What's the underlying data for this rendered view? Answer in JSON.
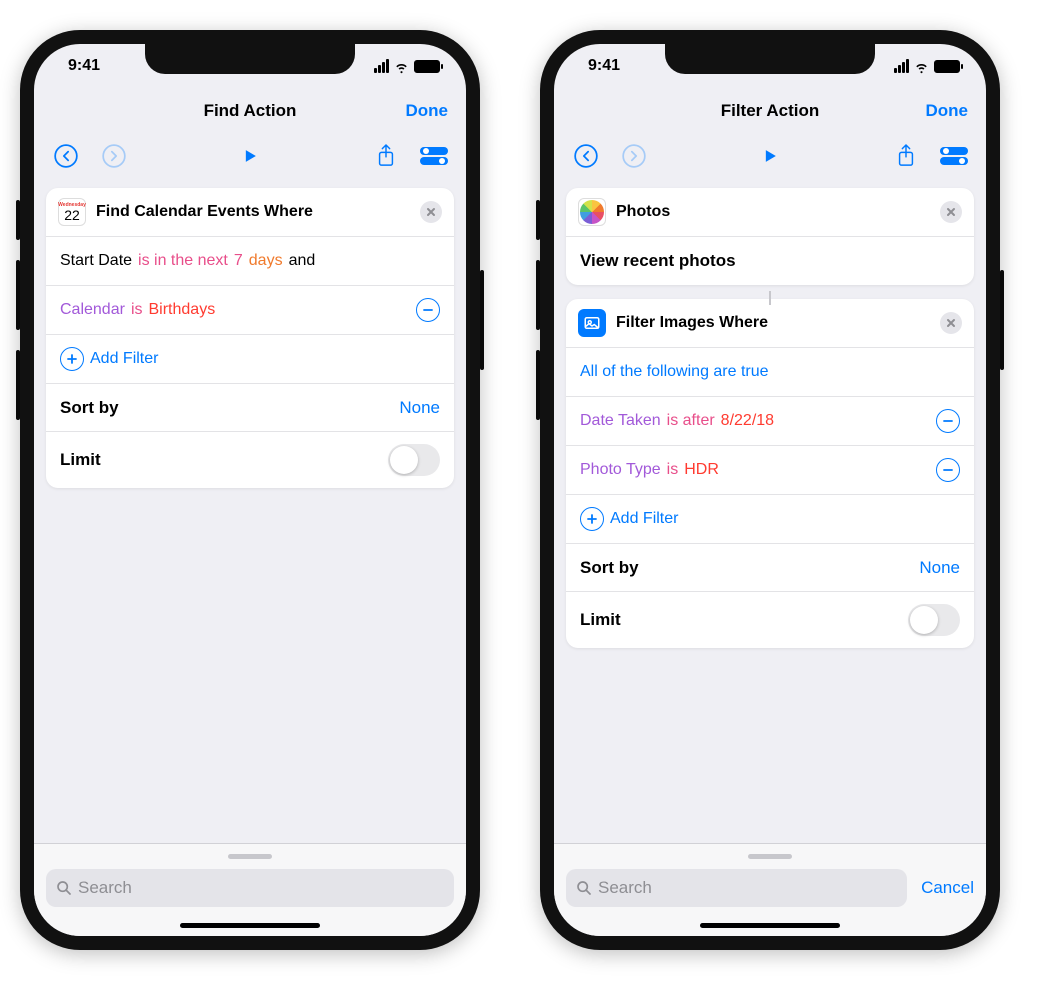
{
  "status": {
    "time": "9:41"
  },
  "left": {
    "nav_title": "Find Action",
    "nav_done": "Done",
    "card": {
      "title": "Find Calendar Events Where",
      "cal_icon": {
        "dow": "Wednesday",
        "day": "22"
      },
      "row1": {
        "field": "Start Date",
        "op": "is in the next",
        "num": "7",
        "unit": "days",
        "conj": "and"
      },
      "row2": {
        "field": "Calendar",
        "op": "is",
        "value": "Birthdays"
      },
      "add_filter": "Add Filter",
      "sort_label": "Sort by",
      "sort_value": "None",
      "limit_label": "Limit"
    },
    "search_placeholder": "Search"
  },
  "right": {
    "nav_title": "Filter Action",
    "nav_done": "Done",
    "photos_card": {
      "title": "Photos",
      "subtitle": "View recent photos"
    },
    "filter_card": {
      "title": "Filter Images Where",
      "all_true": "All of the following are true",
      "row1": {
        "field": "Date Taken",
        "op": "is after",
        "value": "8/22/18"
      },
      "row2": {
        "field": "Photo Type",
        "op": "is",
        "value": "HDR"
      },
      "add_filter": "Add Filter",
      "sort_label": "Sort by",
      "sort_value": "None",
      "limit_label": "Limit"
    },
    "search_placeholder": "Search",
    "cancel": "Cancel"
  }
}
